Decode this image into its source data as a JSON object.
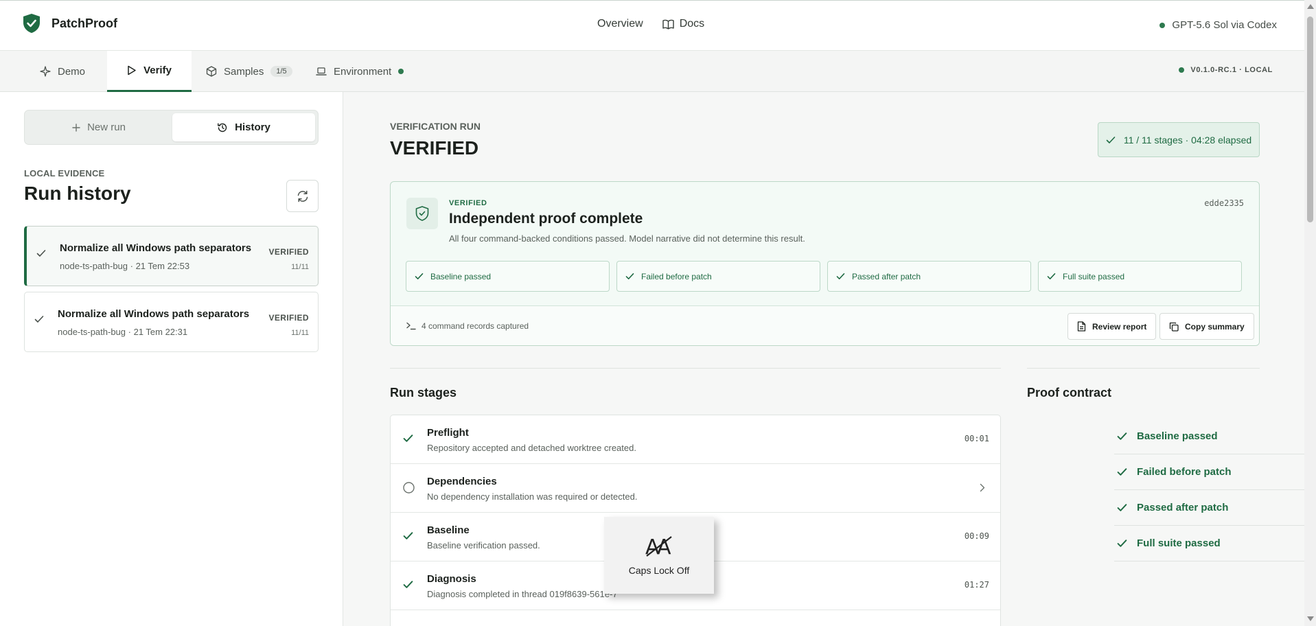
{
  "app": {
    "name": "PatchProof"
  },
  "topnav": {
    "overview": "Overview",
    "docs": "Docs",
    "model": "GPT-5.6 Sol via Codex"
  },
  "tabs": [
    {
      "label": "Demo",
      "icon": "sparkle-icon"
    },
    {
      "label": "Verify",
      "icon": "play-icon",
      "active": true
    },
    {
      "label": "Samples",
      "badge": "1/5",
      "icon": "cube-icon"
    },
    {
      "label": "Environment",
      "icon": "laptop-icon",
      "status": "online"
    }
  ],
  "version": "V0.1.0-RC.1 · LOCAL",
  "left": {
    "segments": {
      "new_run": "New run",
      "history": "History"
    },
    "eyebrow": "LOCAL EVIDENCE",
    "title": "Run history",
    "runs": [
      {
        "title": "Normalize all Windows path separators",
        "sub": "node-ts-path-bug · 21 Tem 22:53",
        "status": "VERIFIED",
        "count": "11/11"
      },
      {
        "title": "Normalize all Windows path separators",
        "sub": "node-ts-path-bug · 21 Tem 22:31",
        "status": "VERIFIED",
        "count": "11/11"
      }
    ]
  },
  "main": {
    "eyebrow": "VERIFICATION RUN",
    "title": "VERIFIED",
    "elapsed": "11 / 11 stages · 04:28 elapsed",
    "card": {
      "eyebrow": "VERIFIED",
      "title": "Independent proof complete",
      "desc": "All four command-backed conditions passed. Model narrative did not determine this result.",
      "commit": "edde2335",
      "conditions": [
        "Baseline passed",
        "Failed before patch",
        "Passed after patch",
        "Full suite passed"
      ],
      "records": "4 command records captured",
      "review": "Review report",
      "copy": "Copy summary"
    },
    "stages_title": "Run stages",
    "stages": [
      {
        "name": "Preflight",
        "desc": "Repository accepted and detached worktree created.",
        "time": "00:01",
        "state": "done"
      },
      {
        "name": "Dependencies",
        "desc": "No dependency installation was required or detected.",
        "time": "",
        "state": "skipped"
      },
      {
        "name": "Baseline",
        "desc": "Baseline verification passed.",
        "time": "00:09",
        "state": "done"
      },
      {
        "name": "Diagnosis",
        "desc": "Diagnosis completed in thread 019f8639-561e-7",
        "time": "01:27",
        "state": "done"
      }
    ],
    "contract_title": "Proof contract",
    "contract": [
      "Baseline passed",
      "Failed before patch",
      "Passed after patch",
      "Full suite passed"
    ]
  },
  "overlay": {
    "text": "Caps Lock Off"
  },
  "colors": {
    "accent": "#1f6b43",
    "success_bg": "#e4f1e9"
  }
}
